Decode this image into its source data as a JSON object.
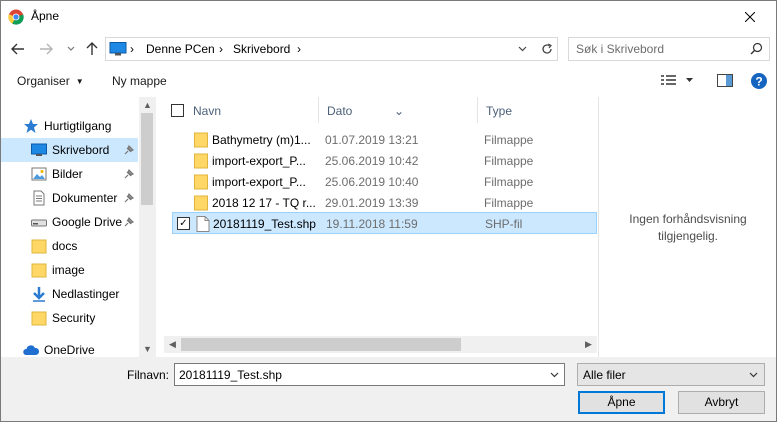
{
  "window": {
    "title": "Åpne"
  },
  "address": {
    "breadcrumb": [
      "Denne PCen",
      "Skrivebord"
    ],
    "search_placeholder": "Søk i Skrivebord"
  },
  "toolbar": {
    "organize_label": "Organiser",
    "new_folder_label": "Ny mappe"
  },
  "nav": {
    "items": [
      {
        "label": "Hurtigtilgang",
        "icon": "star-icon",
        "pinned": false,
        "selected": false
      },
      {
        "label": "Skrivebord",
        "icon": "desktop-icon",
        "pinned": true,
        "selected": true
      },
      {
        "label": "Bilder",
        "icon": "pictures-icon",
        "pinned": true,
        "selected": false
      },
      {
        "label": "Dokumenter",
        "icon": "documents-icon",
        "pinned": true,
        "selected": false
      },
      {
        "label": "Google Drive",
        "icon": "drive-icon",
        "pinned": true,
        "selected": false
      },
      {
        "label": "docs",
        "icon": "folder-icon",
        "pinned": false,
        "selected": false
      },
      {
        "label": "image",
        "icon": "folder-icon",
        "pinned": false,
        "selected": false
      },
      {
        "label": "Nedlastinger",
        "icon": "download-icon",
        "pinned": false,
        "selected": false
      },
      {
        "label": "Security",
        "icon": "folder-icon",
        "pinned": false,
        "selected": false
      },
      {
        "label": "OneDrive",
        "icon": "cloud-icon",
        "pinned": false,
        "selected": false
      }
    ]
  },
  "files": {
    "columns": {
      "name": "Navn",
      "date": "Dato",
      "type": "Type"
    },
    "rows": [
      {
        "name": "Bathymetry (m)1...",
        "date": "01.07.2019 13:21",
        "type": "Filmappe",
        "kind": "folder",
        "selected": false
      },
      {
        "name": "import-export_P...",
        "date": "25.06.2019 10:42",
        "type": "Filmappe",
        "kind": "folder",
        "selected": false
      },
      {
        "name": "import-export_P...",
        "date": "25.06.2019 10:40",
        "type": "Filmappe",
        "kind": "folder",
        "selected": false
      },
      {
        "name": "2018 12 17 - TQ r...",
        "date": "29.01.2019 13:39",
        "type": "Filmappe",
        "kind": "folder",
        "selected": false
      },
      {
        "name": "20181119_Test.shp",
        "date": "19.11.2018 11:59",
        "type": "SHP-fil",
        "kind": "file",
        "selected": true
      }
    ]
  },
  "preview": {
    "message_line1": "Ingen forhåndsvisning",
    "message_line2": "tilgjengelig."
  },
  "footer": {
    "filename_label": "Filnavn:",
    "filename_value": "20181119_Test.shp",
    "filter_value": "Alle filer",
    "open_label": "Åpne",
    "cancel_label": "Avbryt"
  },
  "colors": {
    "accent": "#0078d7",
    "selection": "#cce8ff",
    "folder": "#ffd766"
  }
}
